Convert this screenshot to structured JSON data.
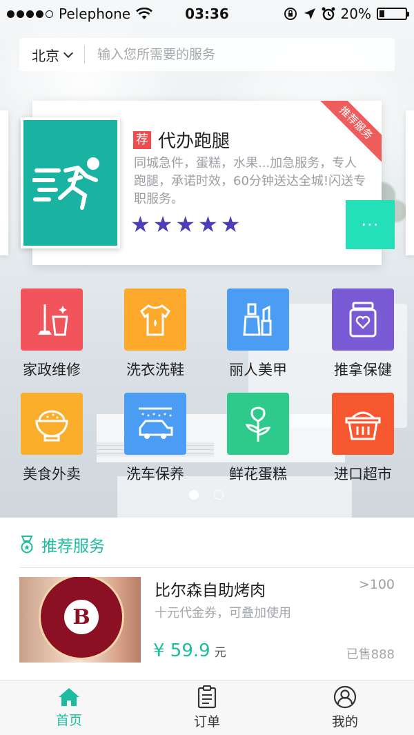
{
  "status_bar": {
    "carrier": "Pelephone",
    "time": "03:36",
    "battery": "20%",
    "battery_level": 0.2,
    "signal_bars": 4
  },
  "search": {
    "city": "北京",
    "placeholder": "输入您所需要的服务"
  },
  "featured": {
    "tag": "荐",
    "title": "代办跑腿",
    "description": "同城急件，蛋糕，水果...加急服务，专人跑腿，承诺时效，60分钟送达全城!闪送专职服务。",
    "rating": 5,
    "ribbon": "推荐服务",
    "more_label": "···",
    "image_bg": "#1ab3a2",
    "star_color": "#4c3fb5",
    "more_color": "#23e0b8"
  },
  "categories": [
    {
      "label": "家政维修",
      "color": "#f2545b",
      "icon": "bucket-mop-icon"
    },
    {
      "label": "洗衣洗鞋",
      "color": "#fdaa2c",
      "icon": "tshirt-icon"
    },
    {
      "label": "丽人美甲",
      "color": "#4a9df2",
      "icon": "nail-polish-icon"
    },
    {
      "label": "推拿保健",
      "color": "#7b5ad6",
      "icon": "massage-jar-icon"
    },
    {
      "label": "美食外卖",
      "color": "#fbad2c",
      "icon": "rice-bowl-icon"
    },
    {
      "label": "洗车保养",
      "color": "#4a9df2",
      "icon": "car-wash-icon"
    },
    {
      "label": "鲜花蛋糕",
      "color": "#2dca8c",
      "icon": "rose-icon"
    },
    {
      "label": "进口超市",
      "color": "#f7582f",
      "icon": "basket-icon"
    }
  ],
  "pager": {
    "pages": 2,
    "active": 1
  },
  "recommended": {
    "title": "推荐服务",
    "items": [
      {
        "name": "比尔森自助烤肉",
        "count": ">100",
        "subtitle": "十元代金券，可叠加使用",
        "price": "¥ 59.9",
        "price_unit": "元",
        "sold": "已售888"
      }
    ]
  },
  "tabs": [
    {
      "label": "首页",
      "icon": "home-icon",
      "active": true
    },
    {
      "label": "订单",
      "icon": "clipboard-icon",
      "active": false
    },
    {
      "label": "我的",
      "icon": "user-icon",
      "active": false
    }
  ],
  "colors": {
    "accent": "#1dbba0",
    "tag_red": "#ef4d4d"
  }
}
